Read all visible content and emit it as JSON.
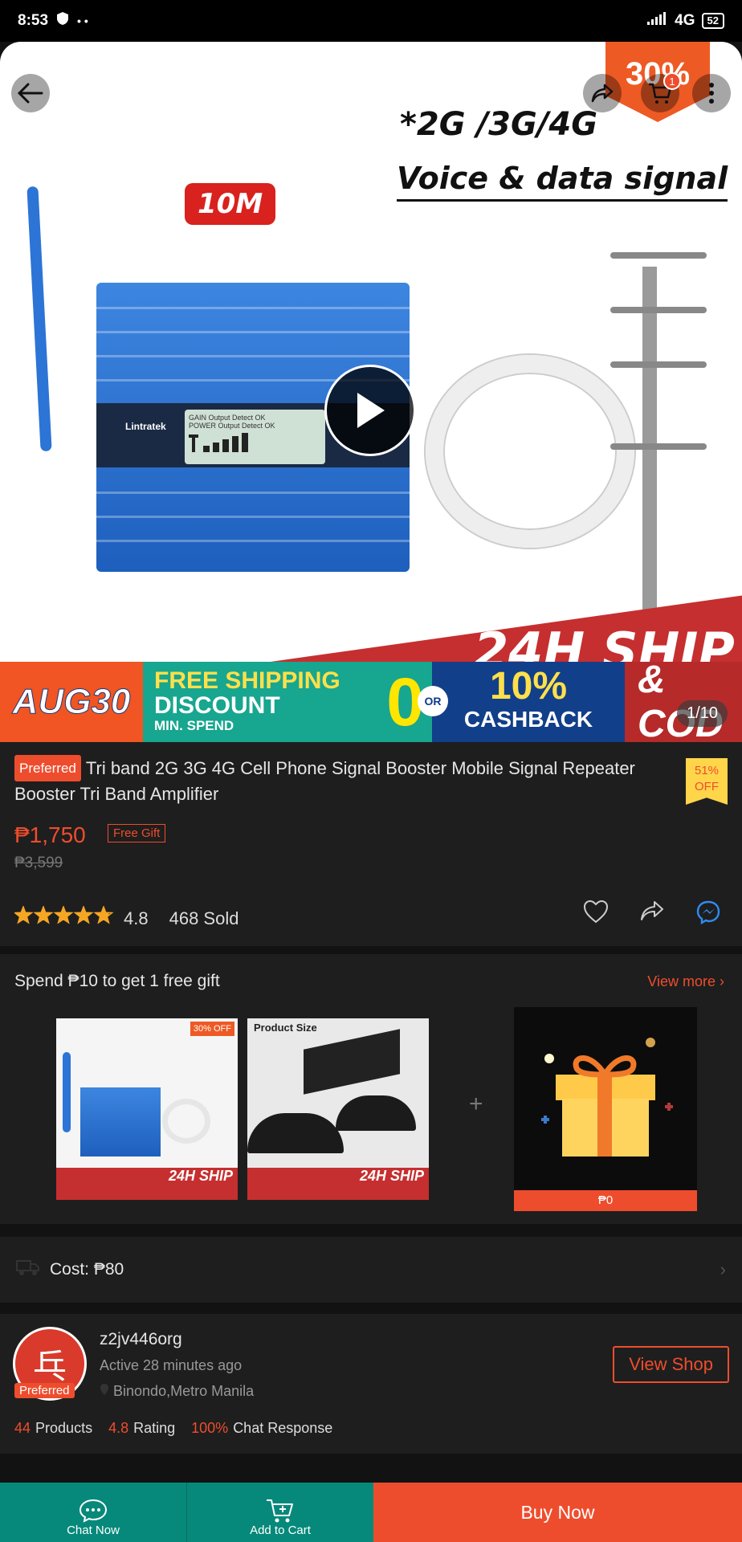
{
  "status": {
    "time": "8:53",
    "network": "4G",
    "battery": "52"
  },
  "hero": {
    "sale_corner": "30% OFF",
    "tagline1": "*2G /3G/4G",
    "tagline2": "Voice & data signal",
    "badge": "10M",
    "lcd_line1": "GAIN Output Detect   OK",
    "lcd_line2": "POWER Output Detect  OK",
    "brand": "Lintratek",
    "ship_text": "24H SHIP",
    "cart_count": "1",
    "image_counter": "1/10"
  },
  "promo": {
    "aug": "AUG30",
    "free_line1": "FREE SHIPPING",
    "free_line2": "DISCOUNT",
    "free_line3": "MIN. SPEND",
    "zero": "0",
    "or": "OR",
    "pct": "10%",
    "cashback": "CASHBACK",
    "cod": "& COD"
  },
  "product": {
    "preferred": "Preferred",
    "title": "Tri band 2G 3G 4G Cell Phone Signal Booster Mobile Signal Repeater Booster Tri Band Amplifier",
    "off_pct": "51%",
    "off_label": "OFF",
    "price": "₱1,750",
    "gift_tag": "Free Gift",
    "original_price": "₱3,599",
    "rating": "4.8",
    "rating_fraction": 0.96,
    "sold": "468 Sold"
  },
  "gift": {
    "heading": "Spend ₱10 to get 1 free gift",
    "view_more": "View more",
    "thumb1_band": "24H SHIP",
    "thumb1_corner": "30% OFF",
    "thumb2_title": "Product Size",
    "thumb2_band": "24H SHIP",
    "plus": "+",
    "gift_price": "₱0"
  },
  "shipping": {
    "cost_label": "Cost: ₱80"
  },
  "shop": {
    "logo_glyph": "乓",
    "preferred": "Preferred",
    "name": "z2jv446org",
    "active": "Active 28 minutes ago",
    "location": "Binondo,Metro Manila",
    "view_shop": "View Shop",
    "products_n": "44",
    "products_label": "Products",
    "rating_n": "4.8",
    "rating_label": "Rating",
    "chat_n": "100%",
    "chat_label": "Chat Response"
  },
  "bottom": {
    "chat": "Chat Now",
    "cart": "Add to Cart",
    "buy": "Buy Now"
  },
  "colors": {
    "accent": "#ee4d2d",
    "teal": "#06897a",
    "bg": "#1e1e1e"
  }
}
